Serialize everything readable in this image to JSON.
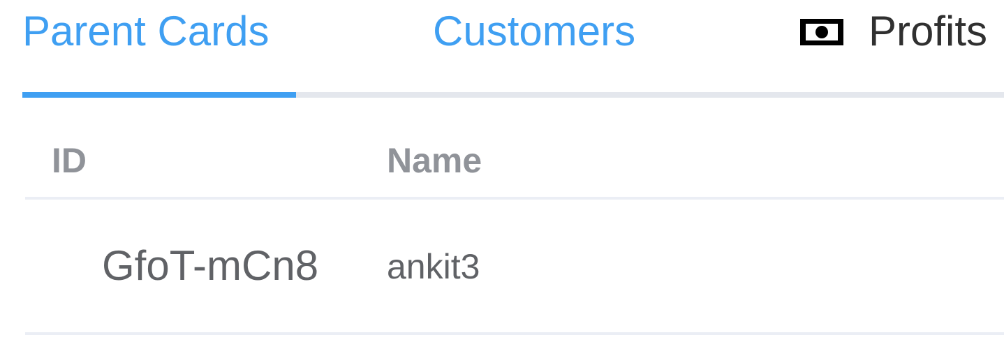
{
  "tabs": {
    "items": [
      {
        "label": "Parent Cards",
        "active": true
      },
      {
        "label": "Customers",
        "active": false
      },
      {
        "label": "Profits",
        "active": false,
        "icon": "money-icon"
      }
    ],
    "accent_color": "#3f9ff2"
  },
  "table": {
    "columns": [
      "ID",
      "Name"
    ],
    "rows": [
      {
        "id": "GfoT-mCn8",
        "name": "ankit3"
      }
    ]
  }
}
